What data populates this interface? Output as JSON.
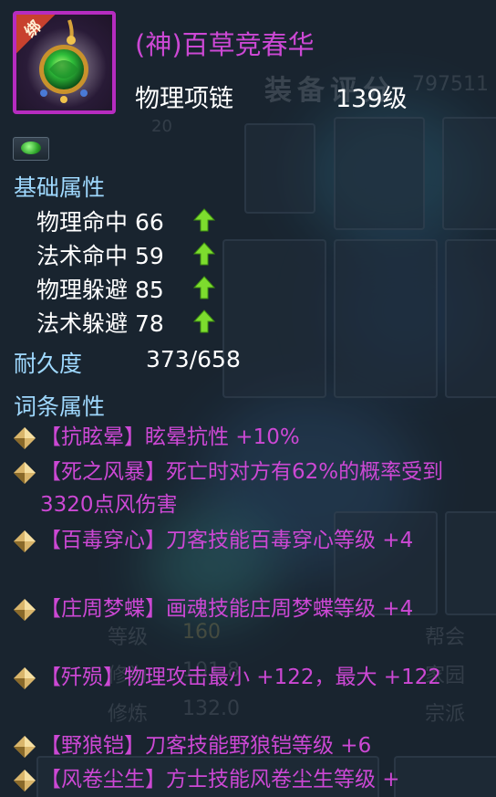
{
  "item": {
    "bind_tag": "绑",
    "title": "(神)百草竞春华",
    "type": "物理项链",
    "level": "139级",
    "frame_color": "#b62cc0",
    "title_color": "#cc48d4",
    "icon": "jade-necklace-icon"
  },
  "base": {
    "heading": "基础属性",
    "stats": [
      {
        "label": "物理命中",
        "value": "66"
      },
      {
        "label": "法术命中",
        "value": "59"
      },
      {
        "label": "物理躲避",
        "value": "85"
      },
      {
        "label": "法术躲避",
        "value": "78"
      }
    ],
    "up_arrow_color": "#7ddc2e"
  },
  "durability": {
    "label": "耐久度",
    "value": "373/658"
  },
  "affix": {
    "heading": "词条属性",
    "color": "#cc48d4",
    "items": [
      {
        "text": "【抗眩晕】眩晕抗性 +10%"
      },
      {
        "text": "【死之风暴】死亡时对方有62%的概率受到3320点风伤害"
      },
      {
        "text": "【百毒穿心】刀客技能百毒穿心等级 +4"
      },
      {
        "text": "【庄周梦蝶】画魂技能庄周梦蝶等级 +4"
      },
      {
        "text": "【歼殒】物理攻击最小 +122，最大 +122"
      },
      {
        "text": "【野狼铠】刀客技能野狼铠等级 +6"
      },
      {
        "text": "【风卷尘生】方士技能风卷尘生等级 +"
      }
    ]
  },
  "background": {
    "equip_score_label": "装备评分",
    "equip_score_value": "797511",
    "slot_number": "20",
    "level_label": "等级",
    "level_value": "160",
    "cultivation_label": "修炼",
    "cultivation_value": "132.0",
    "row2_label": "修为",
    "row2_value": "101.8",
    "right_labels": [
      "帮会",
      "家园",
      "宗派"
    ]
  }
}
